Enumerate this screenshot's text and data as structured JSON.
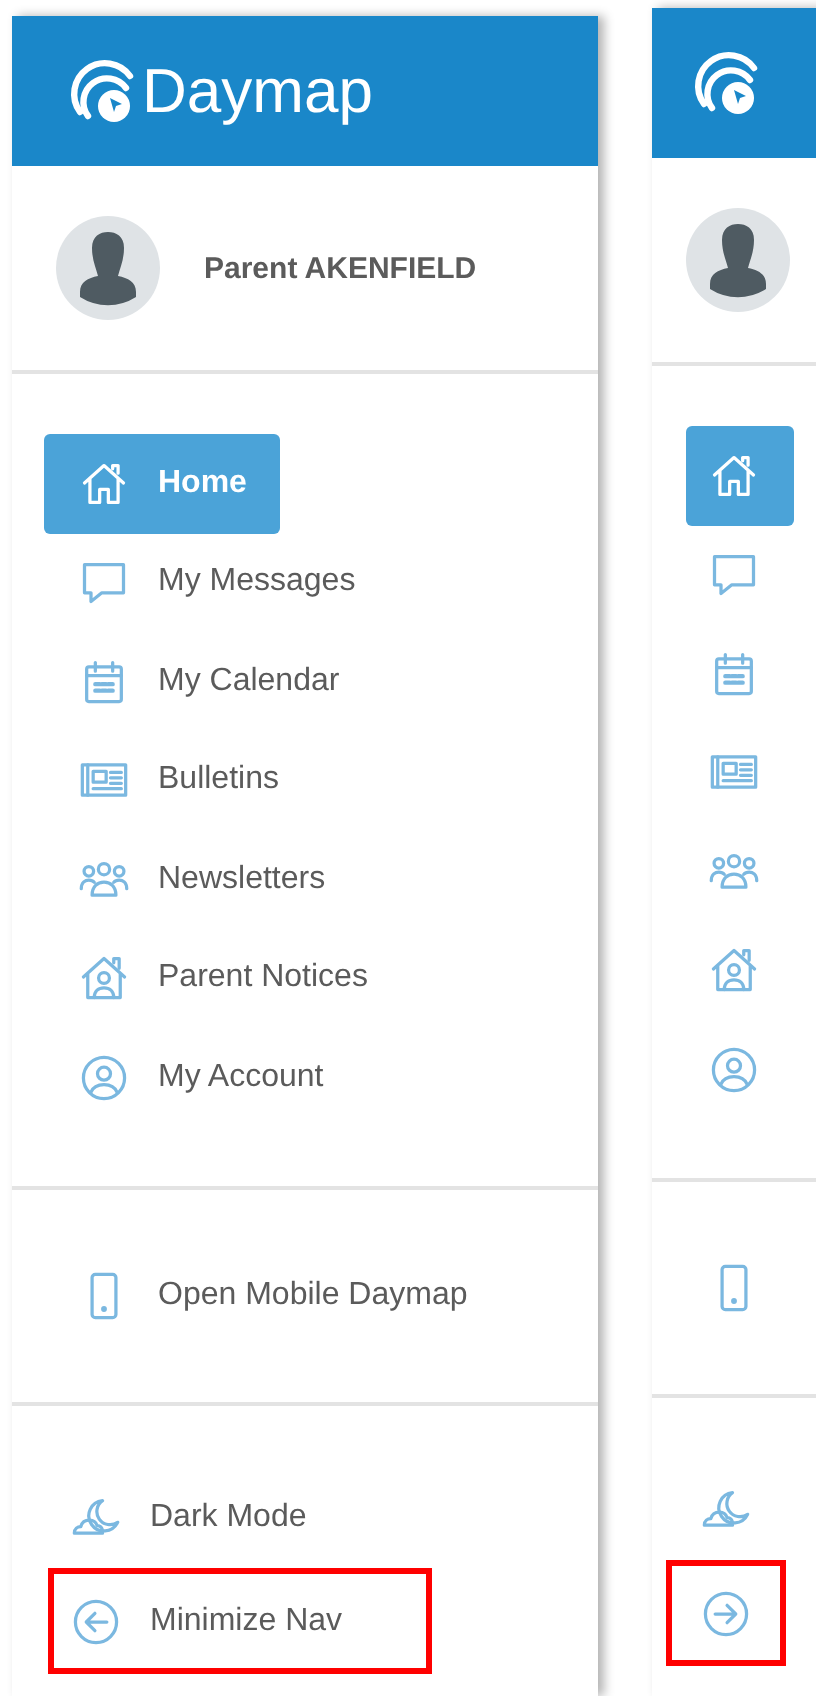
{
  "expanded_nav": {
    "brand": "Daymap",
    "user": {
      "name": "Parent AKENFIELD"
    },
    "menu": [
      {
        "kind": "home",
        "label": "Home",
        "selected": true
      },
      {
        "kind": "message",
        "label": "My Messages",
        "selected": false
      },
      {
        "kind": "calendar",
        "label": "My Calendar",
        "selected": false
      },
      {
        "kind": "bulletin",
        "label": "Bulletins",
        "selected": false
      },
      {
        "kind": "people",
        "label": "Newsletters",
        "selected": false
      },
      {
        "kind": "house-person",
        "label": "Parent Notices",
        "selected": false
      },
      {
        "kind": "account",
        "label": "My Account",
        "selected": false
      }
    ],
    "links": [
      {
        "kind": "phone",
        "label": "Open Mobile Daymap"
      }
    ],
    "footer": [
      {
        "kind": "moon",
        "label": "Dark Mode",
        "highlighted": false
      },
      {
        "kind": "arrow-left",
        "label": "Minimize Nav",
        "highlighted": true
      }
    ]
  },
  "collapsed_nav": {
    "menu": [
      {
        "kind": "home",
        "selected": true
      },
      {
        "kind": "message",
        "selected": false
      },
      {
        "kind": "calendar",
        "selected": false
      },
      {
        "kind": "bulletin",
        "selected": false
      },
      {
        "kind": "people",
        "selected": false
      },
      {
        "kind": "house-person",
        "selected": false
      },
      {
        "kind": "account",
        "selected": false
      }
    ],
    "links": [
      {
        "kind": "phone"
      }
    ],
    "footer": [
      {
        "kind": "moon",
        "highlighted": false
      },
      {
        "kind": "arrow-right",
        "highlighted": true
      }
    ]
  }
}
